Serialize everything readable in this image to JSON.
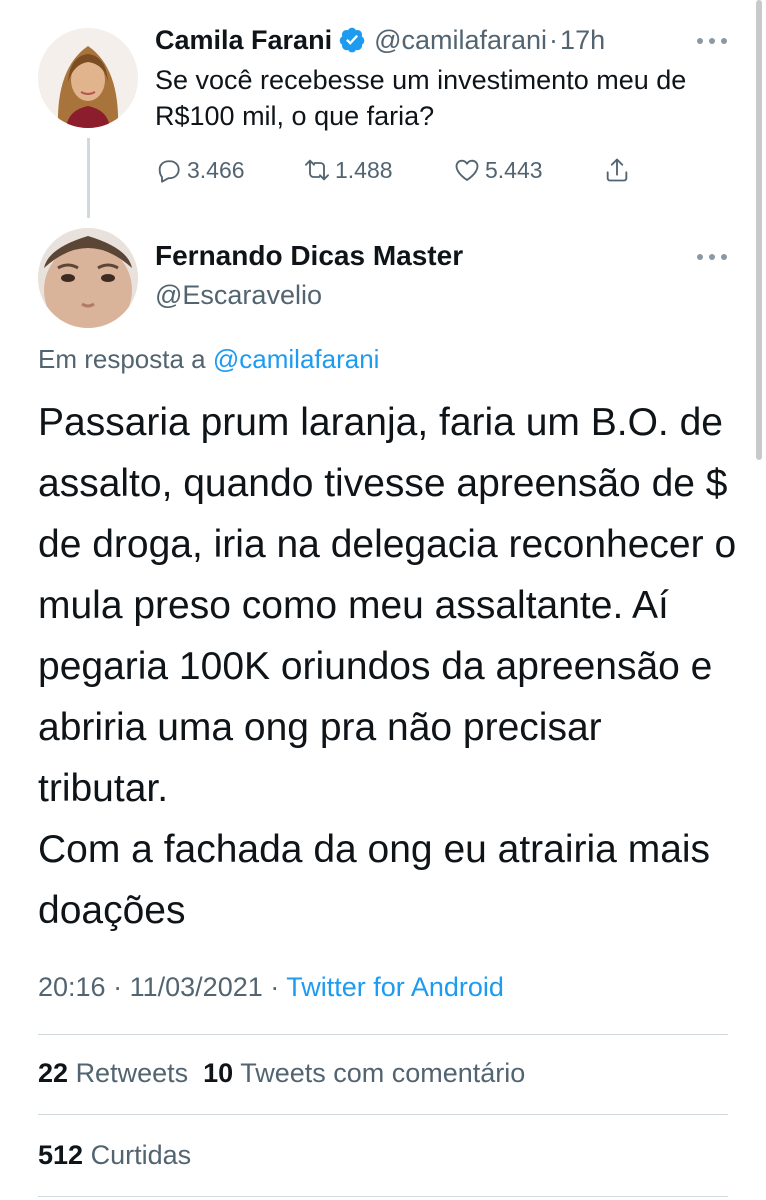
{
  "parent_tweet": {
    "name": "Camila Farani",
    "handle": "@camilafarani",
    "separator": "·",
    "time": "17h",
    "text": "Se você recebesse um investimento meu de R$100 mil, o que faria?",
    "replies": "3.466",
    "retweets": "1.488",
    "likes": "5.443",
    "verified": true
  },
  "reply_tweet": {
    "name": "Fernando Dicas Master",
    "handle": "@Escaravelio",
    "reply_prefix": "Em resposta a",
    "reply_to": "@camilafarani",
    "text": "Passaria prum laranja, faria um B.O. de assalto, quando tivesse apreensão de $ de droga, iria na delegacia reconhecer o mula preso como meu assaltante. Aí pegaria 100K oriundos da apreensão e abriria uma ong pra não precisar tributar.\nCom a fachada da ong eu atrairia mais doações",
    "time": "20:16",
    "date": "11/03/2021",
    "sep": "·",
    "source": "Twitter for Android",
    "retweets_count": "22",
    "retweets_label": "Retweets",
    "quotes_count": "10",
    "quotes_label": "Tweets com comentário",
    "likes_count": "512",
    "likes_label": "Curtidas"
  },
  "colors": {
    "link": "#1d9bf0",
    "secondary_text": "#536471",
    "primary_text": "#0f1419",
    "divider": "#cfd9de"
  }
}
